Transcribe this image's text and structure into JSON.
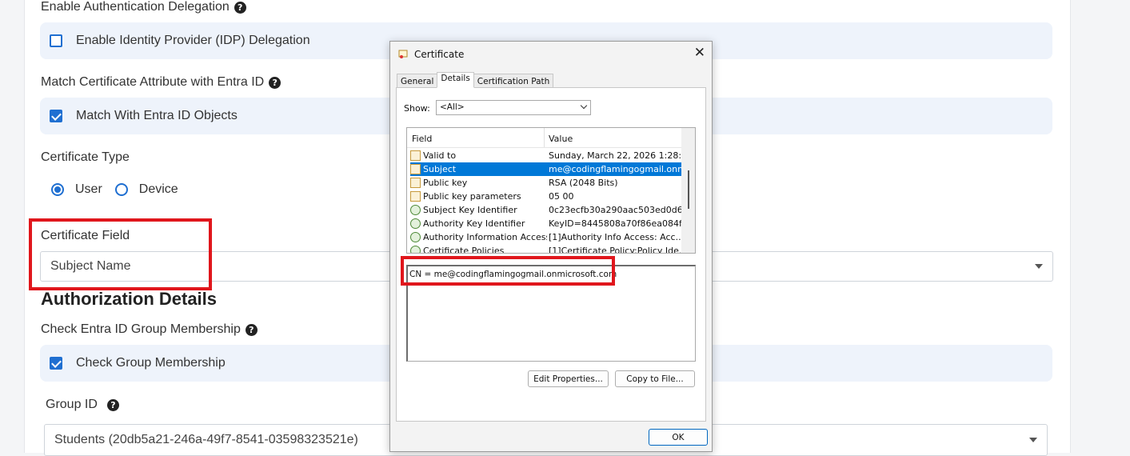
{
  "form": {
    "auth_delegation": {
      "label": "Enable Authentication Delegation",
      "option": "Enable Identity Provider (IDP) Delegation"
    },
    "match_attr": {
      "label": "Match Certificate Attribute with Entra ID",
      "option": "Match With Entra ID Objects"
    },
    "cert_type": {
      "label": "Certificate Type",
      "user": "User",
      "device": "Device",
      "selected": "User"
    },
    "cert_field": {
      "label": "Certificate Field",
      "value": "Subject Name"
    },
    "authorization_title": "Authorization Details",
    "group_membership": {
      "label": "Check Entra ID Group Membership",
      "option": "Check Group Membership"
    },
    "group_id": {
      "label": "Group ID",
      "value": "Students (20db5a21-246a-49f7-8541-03598323521e)"
    }
  },
  "icons": {
    "help": "question-circle-icon",
    "checkbox": "checkbox-icon",
    "certificate": "certificate-icon"
  },
  "colors": {
    "accent": "#1f6fd1",
    "highlight_box": "#e0161c",
    "selection": "#0078d7"
  },
  "dialog": {
    "title": "Certificate",
    "close": "✕",
    "tabs": [
      "General",
      "Details",
      "Certification Path"
    ],
    "active_tab": "Details",
    "show_label": "Show:",
    "show_value": "<All>",
    "columns": {
      "field": "Field",
      "value": "Value"
    },
    "rows": [
      {
        "field": "Valid to",
        "value": "Sunday, March 22, 2026 1:28:...",
        "icon": "doc"
      },
      {
        "field": "Subject",
        "value": "me@codingflamingogmail.onmi...",
        "icon": "doc",
        "selected": true
      },
      {
        "field": "Public key",
        "value": "RSA (2048 Bits)",
        "icon": "doc"
      },
      {
        "field": "Public key parameters",
        "value": "05 00",
        "icon": "doc"
      },
      {
        "field": "Subject Key Identifier",
        "value": "0c23ecfb30a290aac503ed0d6...",
        "icon": "key"
      },
      {
        "field": "Authority Key Identifier",
        "value": "KeyID=8445808a70f86ea084f...",
        "icon": "key"
      },
      {
        "field": "Authority Information Access",
        "value": "[1]Authority Info Access: Acc...",
        "icon": "key"
      },
      {
        "field": "Certificate Policies",
        "value": "[1]Certificate Policy:Policy Ide...",
        "icon": "key"
      }
    ],
    "detail_value": "CN = me@codingflamingogmail.onmicrosoft.com",
    "edit_button": "Edit Properties...",
    "copy_button": "Copy to File...",
    "ok_button": "OK"
  }
}
